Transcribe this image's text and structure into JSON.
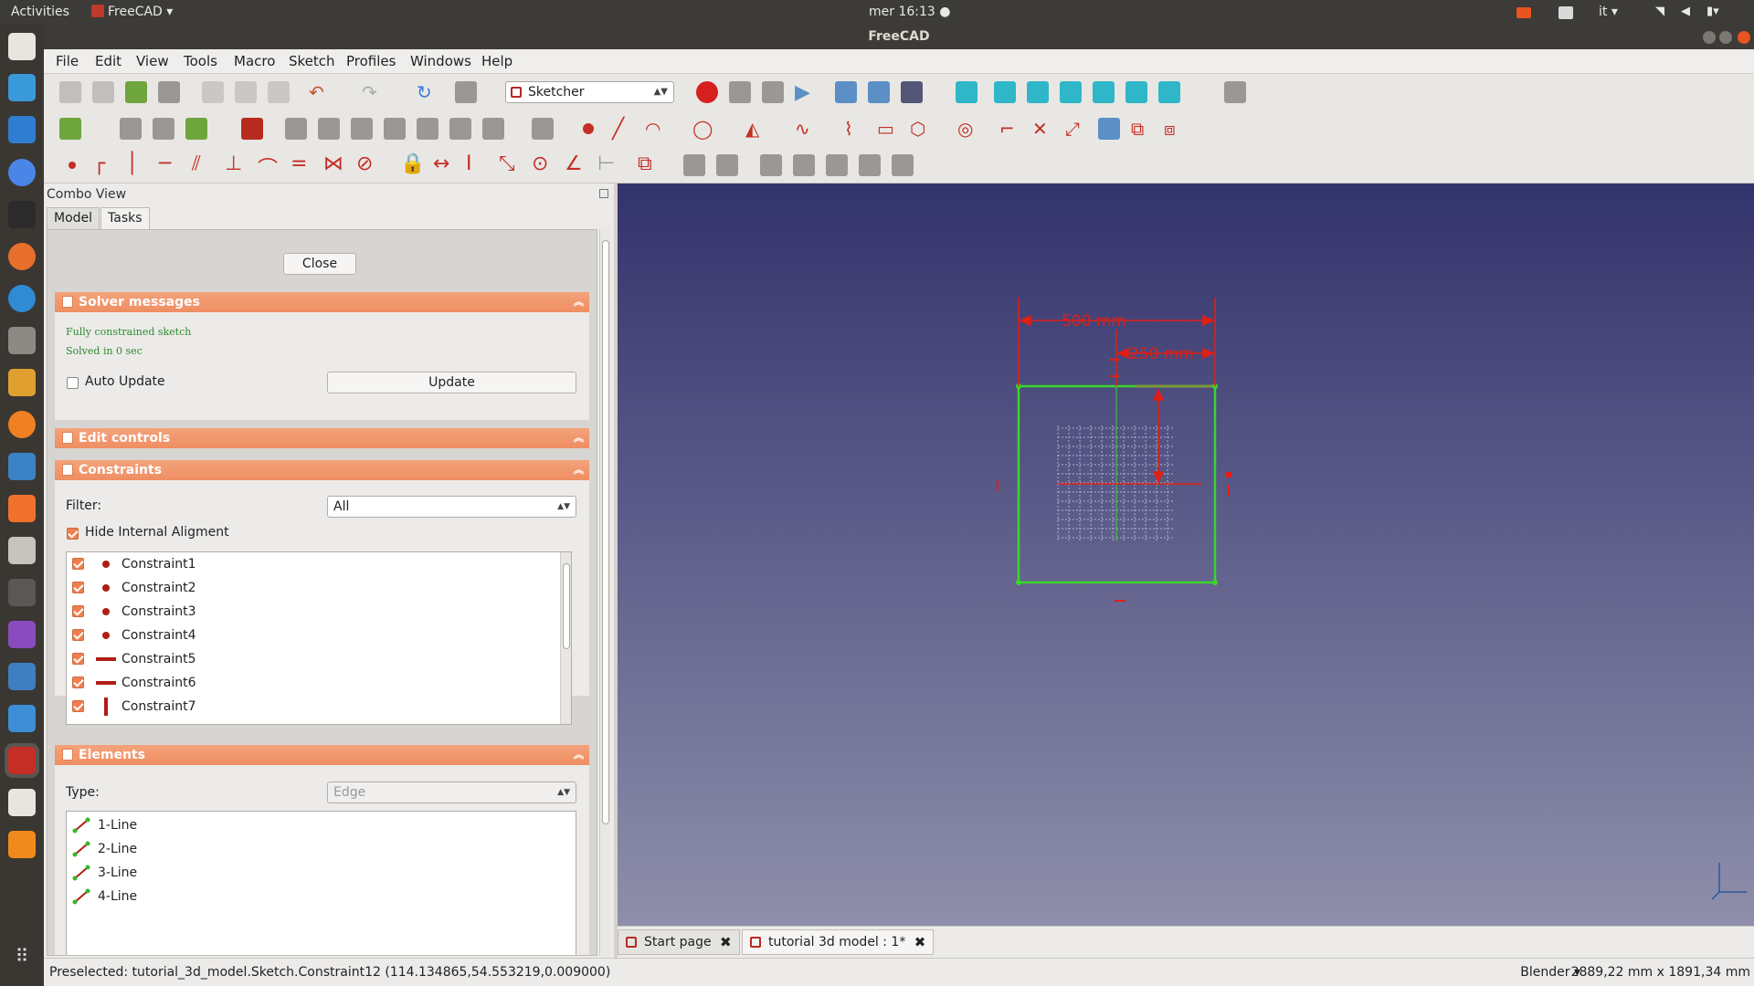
{
  "topbar": {
    "activities": "Activities",
    "app_name": "FreeCAD ▾",
    "clock": "mer 16:13 ●",
    "language": "it ▾"
  },
  "window": {
    "title": "FreeCAD"
  },
  "menu": [
    "File",
    "Edit",
    "View",
    "Tools",
    "Macro",
    "Sketch",
    "Profiles",
    "Windows",
    "Help"
  ],
  "toolbar": {
    "workbench": "Sketcher"
  },
  "combo": {
    "title": "Combo View",
    "tabs": [
      "Model",
      "Tasks"
    ],
    "close_label": "Close",
    "solver": {
      "header": "Solver messages",
      "msg1": "Fully constrained sketch",
      "msg2": "Solved in 0 sec",
      "auto_update_label": "Auto Update",
      "update_label": "Update"
    },
    "edit_controls": {
      "header": "Edit controls"
    },
    "constraints": {
      "header": "Constraints",
      "filter_label": "Filter:",
      "filter_value": "All",
      "hide_internal_label": "Hide Internal Aligment",
      "items": [
        {
          "name": "Constraint1",
          "icon": "point"
        },
        {
          "name": "Constraint2",
          "icon": "point"
        },
        {
          "name": "Constraint3",
          "icon": "point"
        },
        {
          "name": "Constraint4",
          "icon": "point"
        },
        {
          "name": "Constraint5",
          "icon": "horizontal"
        },
        {
          "name": "Constraint6",
          "icon": "horizontal"
        },
        {
          "name": "Constraint7",
          "icon": "vertical"
        }
      ]
    },
    "elements": {
      "header": "Elements",
      "type_label": "Type:",
      "type_value": "Edge",
      "items": [
        "1-Line",
        "2-Line",
        "3-Line",
        "4-Line"
      ]
    }
  },
  "sketch": {
    "dim_top": "500 mm",
    "dim_second": "250 mm",
    "colors": {
      "edge": "#39d52b",
      "constraint": "#e01f15"
    }
  },
  "doc_tabs": [
    "Start page",
    "tutorial 3d model : 1*"
  ],
  "status": {
    "preselected": "Preselected: tutorial_3d_model.Sketch.Constraint12 (114.134865,54.553219,0.009000)",
    "nav_style": "Blender ▾",
    "dimensions": "2889,22 mm x 1891,34 mm"
  }
}
